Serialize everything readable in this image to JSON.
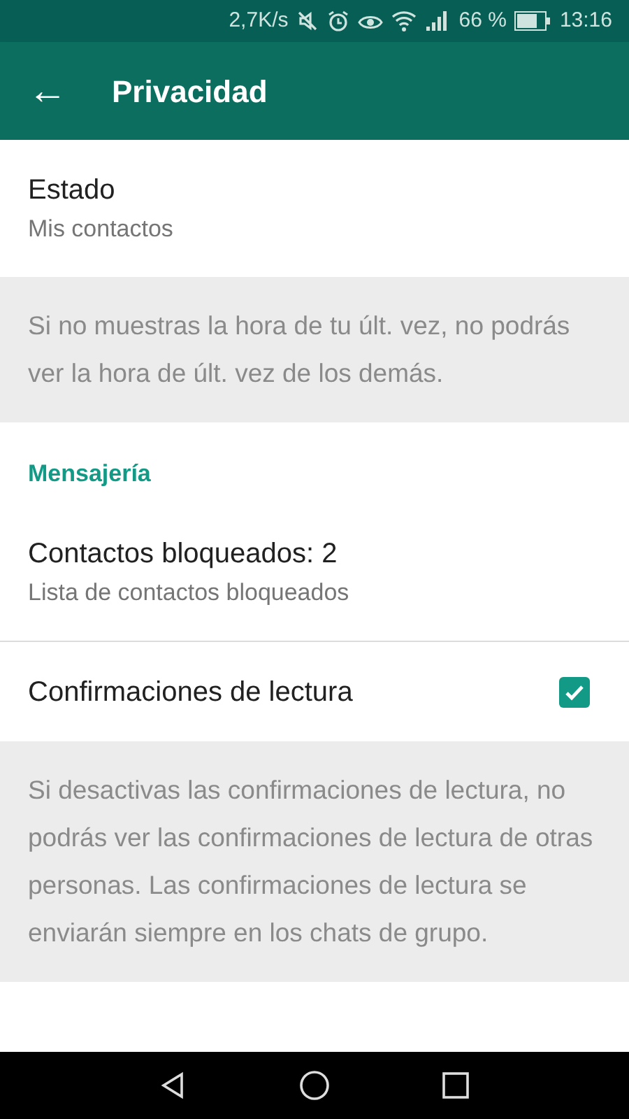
{
  "status_bar": {
    "speed": "2,7K/s",
    "battery_percent": "66 %",
    "time": "13:16"
  },
  "toolbar": {
    "back": "←",
    "title": "Privacidad"
  },
  "items": [
    {
      "kind": "setting",
      "title": "Estado",
      "subtitle": "Mis contactos"
    },
    {
      "kind": "note",
      "text": "Si no muestras la hora de tu últ. vez, no podrás ver la hora de últ. vez de los demás."
    },
    {
      "kind": "header",
      "text": "Mensajería"
    },
    {
      "kind": "setting",
      "title": "Contactos bloqueados: 2",
      "subtitle": "Lista de contactos bloqueados"
    },
    {
      "kind": "toggle",
      "title": "Confirmaciones de lectura",
      "checked": true
    },
    {
      "kind": "note",
      "text": "Si desactivas las confirmaciones de lectura, no podrás ver las confirmaciones de lectura de otras personas. Las confirmaciones de lectura se enviarán siempre en los chats de grupo."
    }
  ]
}
